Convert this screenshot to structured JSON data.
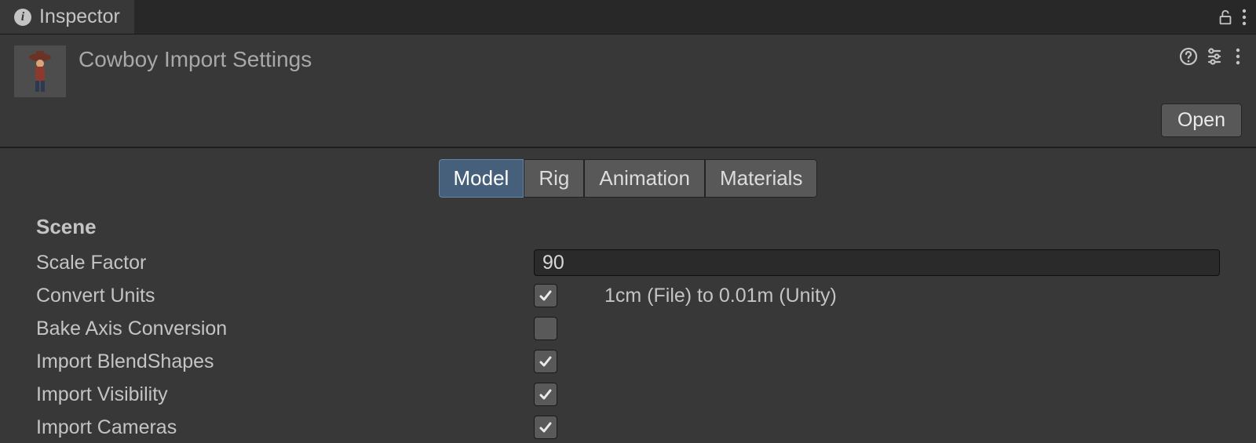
{
  "panel": {
    "title": "Inspector"
  },
  "header": {
    "asset_name": "Cowboy Import Settings",
    "open_label": "Open"
  },
  "tabs": {
    "model": "Model",
    "rig": "Rig",
    "animation": "Animation",
    "materials": "Materials",
    "active": "model"
  },
  "section": {
    "title": "Scene"
  },
  "fields": {
    "scale_factor": {
      "label": "Scale Factor",
      "value": "90"
    },
    "convert_units": {
      "label": "Convert Units",
      "checked": true,
      "extra": "1cm (File) to 0.01m (Unity)"
    },
    "bake_axis": {
      "label": "Bake Axis Conversion",
      "checked": false
    },
    "import_blendshapes": {
      "label": "Import BlendShapes",
      "checked": true
    },
    "import_visibility": {
      "label": "Import Visibility",
      "checked": true
    },
    "import_cameras": {
      "label": "Import Cameras",
      "checked": true
    }
  }
}
